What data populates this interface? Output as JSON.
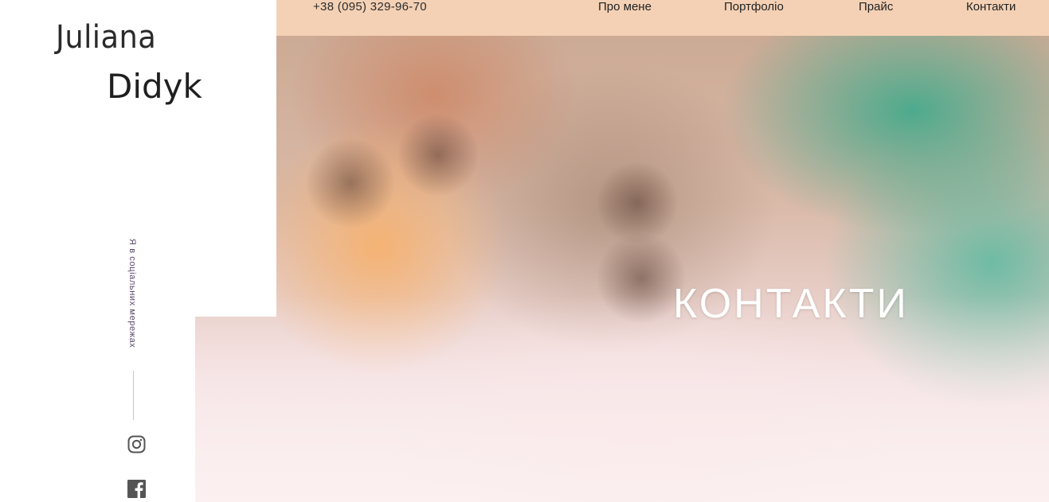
{
  "logo": {
    "first_name": "Juliana",
    "last_name": "Didyk"
  },
  "header": {
    "phone": "+38 (095) 329-96-70",
    "nav": [
      "Про мене",
      "Портфоліо",
      "Прайс",
      "Контакти"
    ]
  },
  "social": {
    "label": "Я в соціальних мережах",
    "icons": [
      "instagram-icon",
      "facebook-icon"
    ]
  },
  "hero": {
    "title": "КОНТАКТИ"
  },
  "colors": {
    "topbar": "#f4d1b5",
    "accent_line": "#e4bfa4",
    "title": "#ffffff"
  }
}
